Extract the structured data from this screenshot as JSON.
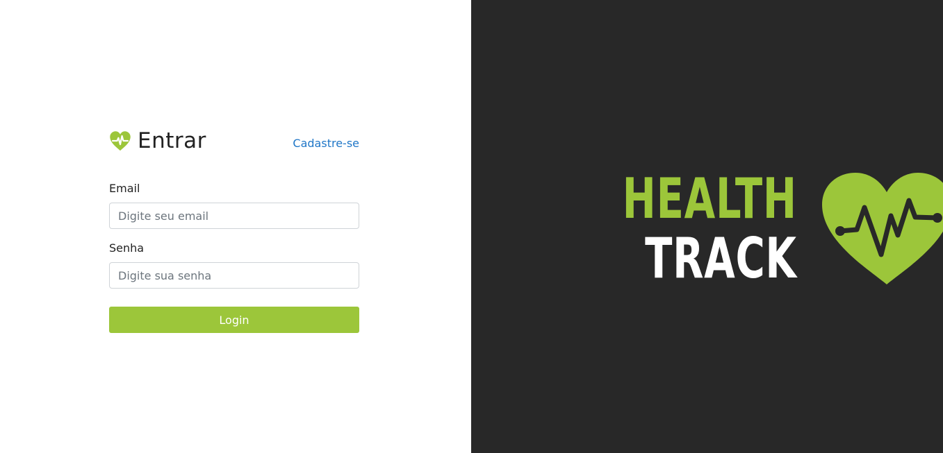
{
  "login": {
    "title": "Entrar",
    "register_link": "Cadastre-se",
    "email_label": "Email",
    "email_placeholder": "Digite seu email",
    "email_value": "",
    "password_label": "Senha",
    "password_placeholder": "Digite sua senha",
    "password_value": "",
    "submit_label": "Login",
    "icon": "heart-pulse-icon"
  },
  "brand": {
    "word_1": "HEALTH",
    "word_2": "TRACK",
    "icon": "heart-pulse-icon"
  },
  "colors": {
    "accent_green": "#9cc63a",
    "link_blue": "#1f76c7",
    "dark_background": "#282828",
    "light_background": "#ffffff"
  }
}
